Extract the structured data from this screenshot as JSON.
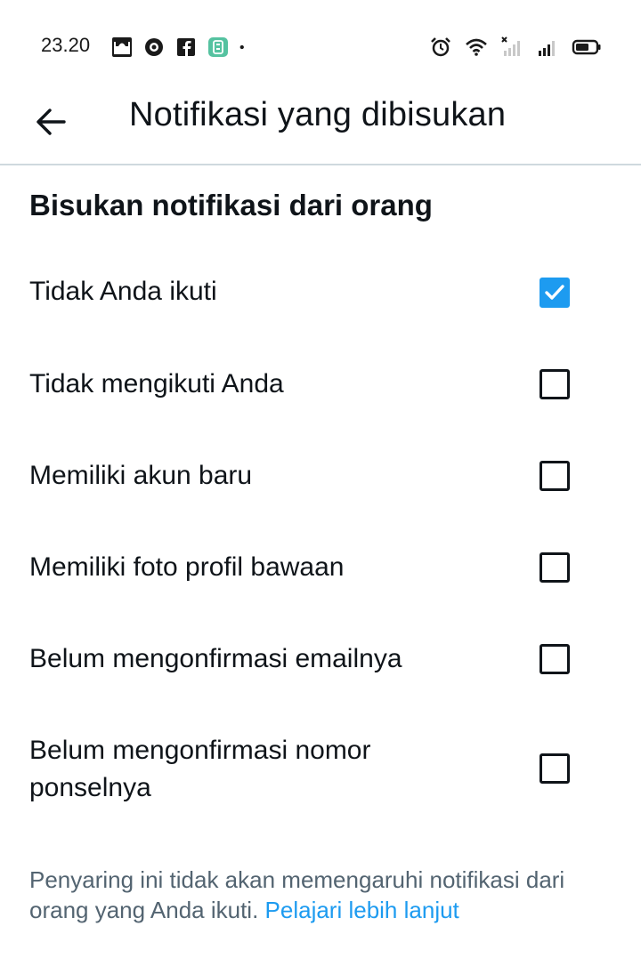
{
  "status_bar": {
    "time": "23.20",
    "left_icons": [
      "mosque-app-icon",
      "circle-app-icon",
      "facebook-icon",
      "calculator-app-icon",
      "notification-dot-icon"
    ],
    "right_icons": [
      "alarm-icon",
      "wifi-icon",
      "no-signal-icon",
      "cell-signal-icon",
      "battery-icon"
    ]
  },
  "header": {
    "back_icon": "arrow-left-icon",
    "title": "Notifikasi yang dibisukan"
  },
  "section": {
    "title": "Bisukan notifikasi dari orang"
  },
  "options": [
    {
      "label": "Tidak Anda ikuti",
      "checked": true
    },
    {
      "label": "Tidak mengikuti Anda",
      "checked": false
    },
    {
      "label": "Memiliki akun baru",
      "checked": false
    },
    {
      "label": "Memiliki foto profil bawaan",
      "checked": false
    },
    {
      "label": "Belum mengonfirmasi emailnya",
      "checked": false
    },
    {
      "label": "Belum mengonfirmasi nomor ponselnya",
      "checked": false
    }
  ],
  "footer": {
    "text": "Penyaring ini tidak akan memengaruhi notifikasi dari orang yang Anda ikuti.",
    "link": "Pelajari lebih lanjut"
  },
  "colors": {
    "accent": "#1d9bf0",
    "text_primary": "#0f1419",
    "text_secondary": "#536471",
    "divider": "#cfd9de"
  }
}
